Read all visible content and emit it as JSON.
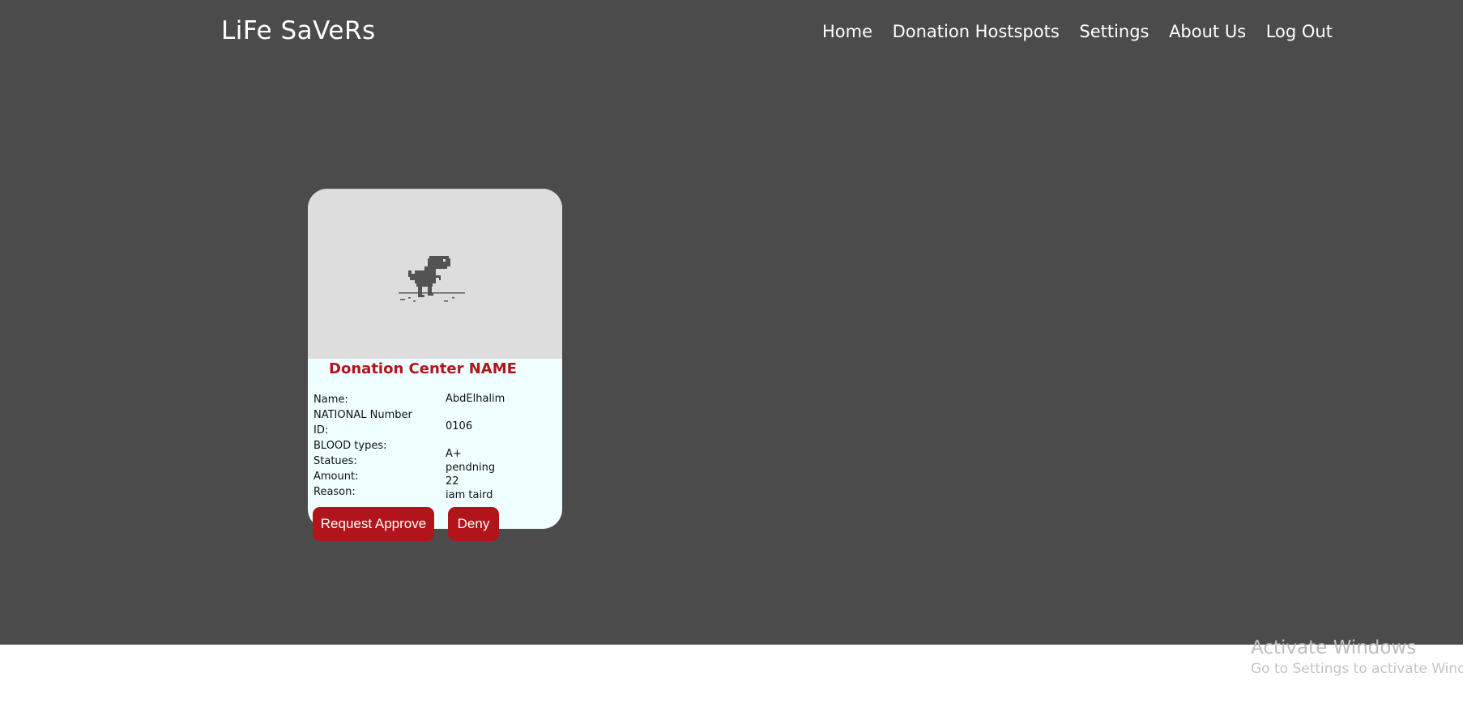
{
  "header": {
    "brand": "LiFe SaVeRs",
    "nav": [
      "Home",
      "Donation Hostspots",
      "Settings",
      "About Us",
      "Log Out"
    ]
  },
  "card": {
    "image_icon": "dino-icon",
    "title": "Donation Center NAME",
    "fields": {
      "name_label": "Name:",
      "name_value": "AbdElhalim",
      "national_label_1": "NATIONAL Number",
      "national_label_2": "ID:",
      "national_value": "0106",
      "blood_label": "BLOOD types:",
      "blood_value": "A+",
      "status_label": "Statues:",
      "status_value": "pendning",
      "amount_label": "Amount:",
      "amount_value": "22",
      "reason_label": "Reason:",
      "reason_value": "iam taird"
    },
    "buttons": {
      "approve": "Request Approve",
      "deny": "Deny"
    }
  },
  "watermark": {
    "line1": "Activate Windows",
    "line2": "Go to Settings to activate Windows."
  },
  "colors": {
    "background": "#4b4b4b",
    "accent": "#b1141a",
    "card_bg": "#efffff",
    "image_bg": "#dddddd"
  }
}
